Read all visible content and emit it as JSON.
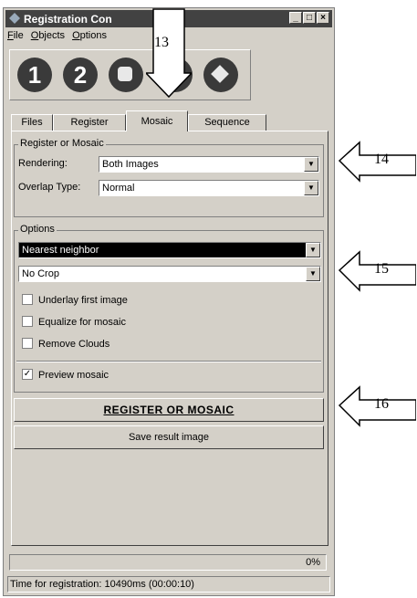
{
  "window": {
    "title": "Registration Con"
  },
  "menu": [
    "File",
    "Objects",
    "Options"
  ],
  "toolbar": [
    "1",
    "2",
    "",
    "",
    ""
  ],
  "tabs": [
    "Files",
    "Register",
    "Mosaic",
    "Sequence"
  ],
  "register_group": {
    "label": "Register or Mosaic",
    "rendering_label": "Rendering:",
    "rendering_value": "Both Images",
    "overlap_label": "Overlap Type:",
    "overlap_value": "Normal"
  },
  "options_group": {
    "label": "Options",
    "interp_value": "Nearest neighbor",
    "crop_value": "No Crop",
    "checks": [
      {
        "label": "Underlay first image",
        "checked": false
      },
      {
        "label": "Equalize for mosaic",
        "checked": false
      },
      {
        "label": "Remove Clouds",
        "checked": false
      }
    ],
    "preview": {
      "label": "Preview mosaic",
      "checked": true
    }
  },
  "buttons": {
    "register": "REGISTER OR MOSAIC",
    "save": "Save result image"
  },
  "progress": {
    "value": 0,
    "label": "0%"
  },
  "status": "Time for registration: 10490ms (00:00:10)",
  "callouts": {
    "c13": "13",
    "c14": "14",
    "c15": "15",
    "c16": "16"
  }
}
